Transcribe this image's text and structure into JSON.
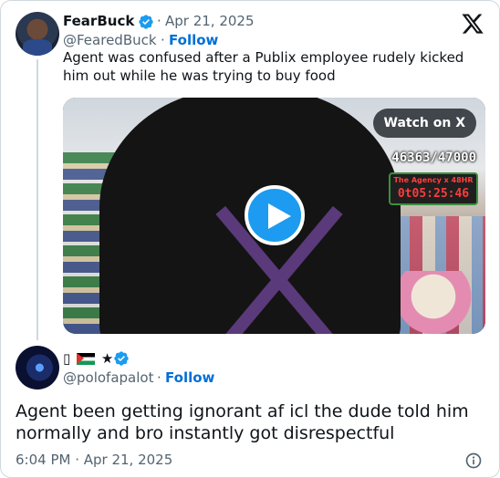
{
  "quoted": {
    "display_name": "FearBuck",
    "dot": "·",
    "date": "Apr 21, 2025",
    "handle": "@FearedBuck",
    "follow_label": "Follow",
    "text": "Agent was confused after a Publix employee rudely kicked him out while he was trying to buy food",
    "media": {
      "watch_label": "Watch on X",
      "counter": "46363/47000",
      "timer_title": "The Agency x 48HR",
      "timer_value": "0t05:25:46"
    }
  },
  "tweet": {
    "display_name_glyph": "▯",
    "display_name_star": "★",
    "handle": "@polofapalot",
    "follow_label": "Follow",
    "dot": "·",
    "text": "Agent been getting ignorant af icl the dude told him normally and bro instantly got disrespectful",
    "timestamp": "6:04 PM · Apr 21, 2025"
  },
  "colors": {
    "link": "#006fd6",
    "verified": "#1d9bf0",
    "secondary_text": "#536471",
    "primary_text": "#0f1419"
  }
}
